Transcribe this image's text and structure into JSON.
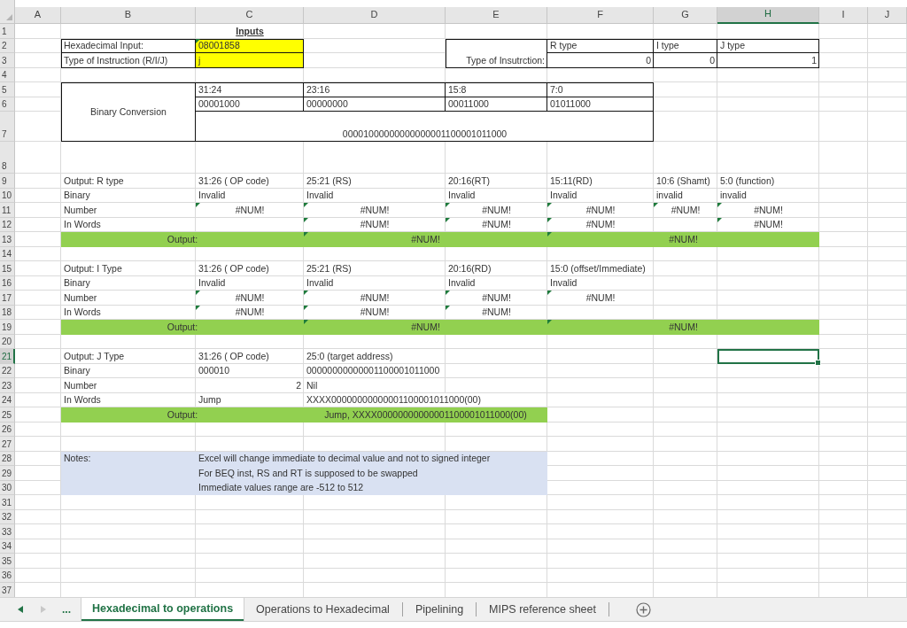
{
  "columns": [
    "A",
    "B",
    "C",
    "D",
    "E",
    "F",
    "G",
    "H",
    "I",
    "J"
  ],
  "rows": [
    {
      "number": "1",
      "cells": {
        "C1": {
          "text": "Inputs",
          "kind": "title"
        }
      }
    },
    {
      "number": "2",
      "cells": {
        "B2": {
          "text": "Hexadecimal Input:",
          "kind": "text",
          "boxed": true
        },
        "C2": {
          "text": "08001858",
          "kind": "text",
          "boxed": true,
          "color": "#ffff00",
          "flagged": true
        },
        "E2:E3": {
          "text": "Type of Insutrction:",
          "kind": "right_label",
          "boxed": true
        },
        "F2": {
          "text": "R type",
          "kind": "text",
          "boxed": true
        },
        "G2": {
          "text": "I type",
          "kind": "text",
          "boxed": true
        },
        "H2": {
          "text": "J type",
          "kind": "text",
          "boxed": true
        }
      }
    },
    {
      "number": "3",
      "cells": {
        "B3": {
          "text": "Type of Instruction (R/I/J)",
          "kind": "text",
          "boxed": true
        },
        "C3": {
          "text": "j",
          "kind": "text",
          "boxed": true,
          "color": "#ffff00"
        },
        "F3": {
          "text": "0",
          "kind": "number",
          "boxed": true
        },
        "G3": {
          "text": "0",
          "kind": "number",
          "boxed": true
        },
        "H3": {
          "text": "1",
          "kind": "number",
          "boxed": true
        }
      }
    },
    {
      "number": "4"
    },
    {
      "number": "5",
      "cells": {
        "B5:B7": {
          "text": "Binary Conversion",
          "kind": "side_title",
          "boxed": true
        },
        "C5": {
          "text": "31:24",
          "kind": "text",
          "boxed": true
        },
        "D5": {
          "text": "23:16",
          "kind": "text",
          "boxed": true
        },
        "E5": {
          "text": "15:8",
          "kind": "text",
          "boxed": true
        },
        "F5": {
          "text": "7:0",
          "kind": "text",
          "boxed": true
        }
      }
    },
    {
      "number": "6",
      "cells": {
        "C6": {
          "text": "00001000",
          "kind": "text",
          "boxed": true
        },
        "D6": {
          "text": "00000000",
          "kind": "text",
          "boxed": true
        },
        "E6": {
          "text": "00011000",
          "kind": "text",
          "boxed": true
        },
        "F6": {
          "text": "01011000",
          "kind": "text",
          "boxed": true
        }
      }
    },
    {
      "number": "7",
      "cells": {
        "C7:F7": {
          "text": "00001000000000000001100001011000",
          "kind": "centered",
          "boxed": true
        }
      }
    },
    {
      "number": "8"
    },
    {
      "number": "9",
      "cells": {
        "B9": {
          "text": "Output: R type",
          "kind": "text"
        },
        "C9": {
          "text": "31:26 ( OP code)",
          "kind": "text"
        },
        "D9": {
          "text": "25:21 (RS)",
          "kind": "text"
        },
        "E9": {
          "text": "20:16(RT)",
          "kind": "text"
        },
        "F9": {
          "text": "15:11(RD)",
          "kind": "text"
        },
        "G9": {
          "text": "10:6 (Shamt)",
          "kind": "text"
        },
        "H9": {
          "text": "5:0 (function)",
          "kind": "text"
        }
      }
    },
    {
      "number": "10",
      "cells": {
        "B10": {
          "text": "Binary",
          "kind": "text"
        },
        "C10": {
          "text": "Invalid",
          "kind": "text"
        },
        "D10": {
          "text": "Invalid",
          "kind": "text"
        },
        "E10": {
          "text": "Invalid",
          "kind": "text"
        },
        "F10": {
          "text": "Invalid",
          "kind": "text"
        },
        "G10": {
          "text": "invalid",
          "kind": "text"
        },
        "H10": {
          "text": "invalid",
          "kind": "text"
        }
      }
    },
    {
      "number": "11",
      "cells": {
        "B11": {
          "text": "Number",
          "kind": "text"
        },
        "C11": {
          "text": "#NUM!",
          "kind": "error",
          "flagged": true
        },
        "D11": {
          "text": "#NUM!",
          "kind": "error",
          "flagged": true
        },
        "E11": {
          "text": "#NUM!",
          "kind": "error",
          "flagged": true
        },
        "F11": {
          "text": "#NUM!",
          "kind": "error",
          "flagged": true
        },
        "G11": {
          "text": "#NUM!",
          "kind": "error",
          "flagged": true
        },
        "H11": {
          "text": "#NUM!",
          "kind": "error",
          "flagged": true
        }
      }
    },
    {
      "number": "12",
      "cells": {
        "B12": {
          "text": "In Words",
          "kind": "text"
        },
        "D12": {
          "text": "#NUM!",
          "kind": "error",
          "flagged": true
        },
        "E12": {
          "text": "#NUM!",
          "kind": "error",
          "flagged": true
        },
        "F12": {
          "text": "#NUM!",
          "kind": "error",
          "flagged": true
        },
        "H12": {
          "text": "#NUM!",
          "kind": "error",
          "flagged": true
        }
      }
    },
    {
      "number": "13",
      "cells": {
        "B13:C13": {
          "text": "Output:",
          "kind": "centered",
          "color": "#92d050"
        },
        "D13:E13": {
          "text": "#NUM!",
          "kind": "centered",
          "color": "#92d050",
          "flagged": true
        },
        "F13:H13": {
          "text": "#NUM!",
          "kind": "centered",
          "color": "#92d050",
          "flagged": true
        }
      }
    },
    {
      "number": "14"
    },
    {
      "number": "15",
      "cells": {
        "B15": {
          "text": "Output: I Type",
          "kind": "text"
        },
        "C15": {
          "text": "31:26 ( OP code)",
          "kind": "text"
        },
        "D15": {
          "text": "25:21 (RS)",
          "kind": "text"
        },
        "E15": {
          "text": "20:16(RD)",
          "kind": "text"
        },
        "F15": {
          "text": "15:0 (offset/Immediate)",
          "kind": "text"
        }
      }
    },
    {
      "number": "16",
      "cells": {
        "B16": {
          "text": "Binary",
          "kind": "text"
        },
        "C16": {
          "text": "Invalid",
          "kind": "text"
        },
        "D16": {
          "text": "Invalid",
          "kind": "text"
        },
        "E16": {
          "text": "Invalid",
          "kind": "text"
        },
        "F16": {
          "text": "Invalid",
          "kind": "text"
        }
      }
    },
    {
      "number": "17",
      "cells": {
        "B17": {
          "text": "Number",
          "kind": "text"
        },
        "C17": {
          "text": "#NUM!",
          "kind": "error",
          "flagged": true
        },
        "D17": {
          "text": "#NUM!",
          "kind": "error",
          "flagged": true
        },
        "E17": {
          "text": "#NUM!",
          "kind": "error",
          "flagged": true
        },
        "F17": {
          "text": "#NUM!",
          "kind": "error",
          "flagged": true
        }
      }
    },
    {
      "number": "18",
      "cells": {
        "B18": {
          "text": "In Words",
          "kind": "text"
        },
        "C18": {
          "text": "#NUM!",
          "kind": "error",
          "flagged": true
        },
        "D18": {
          "text": "#NUM!",
          "kind": "error",
          "flagged": true
        },
        "E18": {
          "text": "#NUM!",
          "kind": "error",
          "flagged": true
        }
      }
    },
    {
      "number": "19",
      "cells": {
        "B19:C19": {
          "text": "Output:",
          "kind": "centered",
          "color": "#92d050"
        },
        "D19:E19": {
          "text": "#NUM!",
          "kind": "centered",
          "color": "#92d050",
          "flagged": true
        },
        "F19:H19": {
          "text": "#NUM!",
          "kind": "centered",
          "color": "#92d050",
          "flagged": true
        }
      }
    },
    {
      "number": "20"
    },
    {
      "number": "21",
      "cells": {
        "B21": {
          "text": "Output: J Type",
          "kind": "text"
        },
        "C21": {
          "text": "31:26 ( OP code)",
          "kind": "text"
        },
        "D21": {
          "text": "25:0 (target address)",
          "kind": "text"
        },
        "H21": {
          "selected": true
        }
      }
    },
    {
      "number": "22",
      "cells": {
        "B22": {
          "text": "Binary",
          "kind": "text"
        },
        "C22": {
          "text": "000010",
          "kind": "text"
        },
        "D22": {
          "text": "00000000000001100001011000",
          "kind": "text"
        }
      }
    },
    {
      "number": "23",
      "cells": {
        "B23": {
          "text": "Number",
          "kind": "text"
        },
        "C23": {
          "text": "2",
          "kind": "number"
        },
        "D23": {
          "text": "Nil",
          "kind": "text"
        }
      }
    },
    {
      "number": "24",
      "cells": {
        "B24": {
          "text": "In Words",
          "kind": "text"
        },
        "C24": {
          "text": "Jump",
          "kind": "text"
        },
        "D24": {
          "text": "XXXX00000000000001100001011000(00)",
          "kind": "text"
        }
      }
    },
    {
      "number": "25",
      "cells": {
        "B25:C25": {
          "text": "Output:",
          "kind": "centered",
          "color": "#92d050"
        },
        "D25:E25": {
          "text": "Jump, XXXX00000000000001100001011000(00)",
          "kind": "centered",
          "color": "#92d050"
        }
      }
    },
    {
      "number": "26"
    },
    {
      "number": "27"
    },
    {
      "number": "28",
      "cells": {
        "B28": {
          "text": "Notes:",
          "kind": "text",
          "color": "#d9e1f2"
        },
        "C28:E28": {
          "text": "Excel will change immediate to decimal value and not to signed integer",
          "kind": "text",
          "color": "#d9e1f2"
        }
      }
    },
    {
      "number": "29",
      "cells": {
        "B29": {
          "kind": "text",
          "color": "#d9e1f2"
        },
        "C29:E29": {
          "text": "For BEQ inst, RS and RT is supposed to be swapped",
          "kind": "text",
          "color": "#d9e1f2"
        }
      }
    },
    {
      "number": "30",
      "cells": {
        "B30": {
          "kind": "text",
          "color": "#d9e1f2"
        },
        "C30:E30": {
          "text": "Immediate values range are -512 to 512",
          "kind": "text",
          "color": "#d9e1f2"
        }
      }
    },
    {
      "number": "31"
    },
    {
      "number": "32"
    },
    {
      "number": "33"
    },
    {
      "number": "34"
    },
    {
      "number": "35"
    },
    {
      "number": "36"
    },
    {
      "number": "37"
    }
  ],
  "sheet_tabs_more": "...",
  "sheet_tabs": [
    {
      "label": "Hexadecimal to operations",
      "selected": true
    },
    {
      "label": "Operations to Hexadecimal",
      "selected": false
    },
    {
      "label": "Pipelining",
      "selected": false
    },
    {
      "label": "MIPS reference sheet",
      "selected": false
    }
  ]
}
